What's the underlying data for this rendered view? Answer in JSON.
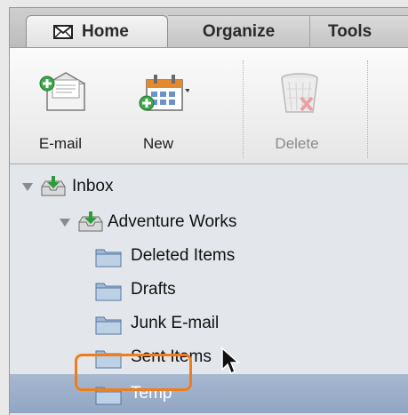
{
  "tabs": [
    {
      "label": "Home",
      "icon": "envelope-icon",
      "active": true
    },
    {
      "label": "Organize",
      "active": false
    },
    {
      "label": "Tools",
      "active": false
    }
  ],
  "ribbon": {
    "email_label": "E-mail",
    "new_label": "New",
    "delete_label": "Delete"
  },
  "tree": {
    "inbox": "Inbox",
    "account": "Adventure Works",
    "folders": [
      "Deleted Items",
      "Drafts",
      "Junk E-mail",
      "Sent Items",
      "Temp"
    ],
    "selected": "Temp"
  },
  "colors": {
    "highlight": "#f07d1c",
    "selection": "#9bb0cb"
  }
}
